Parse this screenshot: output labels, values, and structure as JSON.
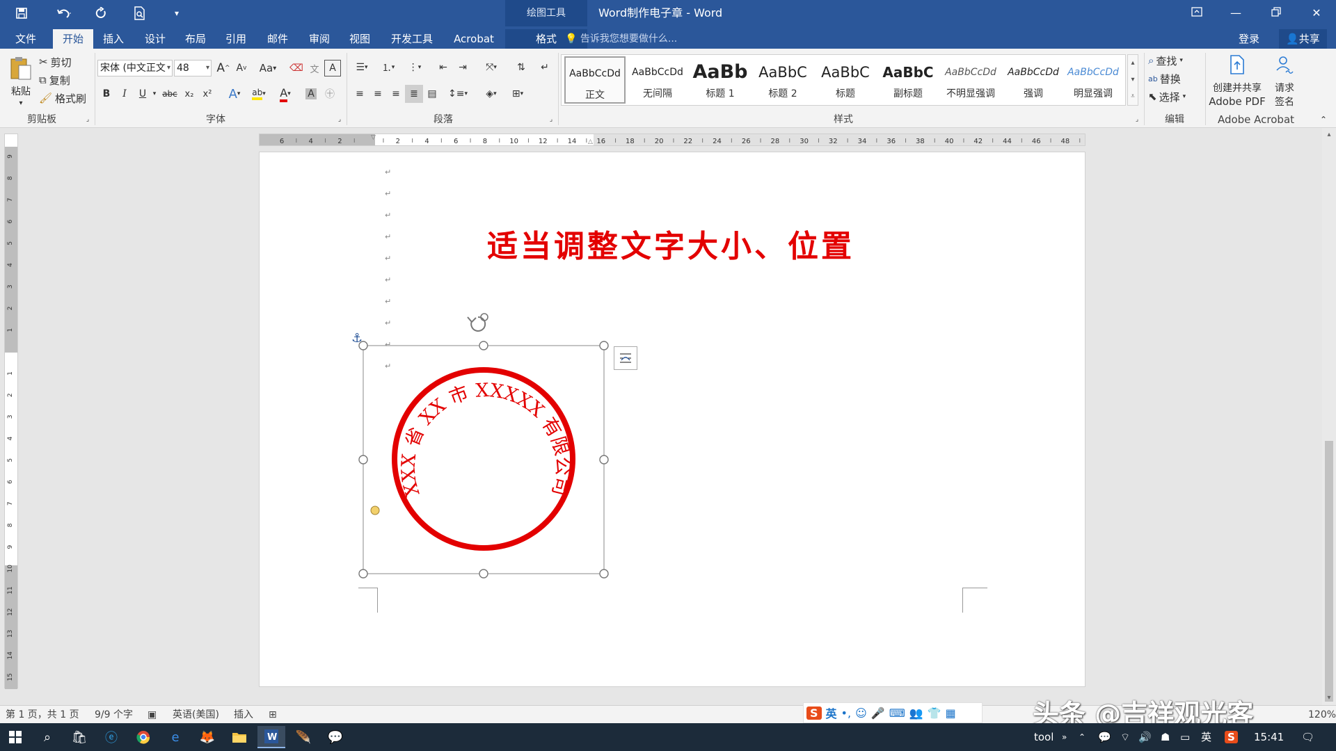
{
  "window": {
    "title": "Word制作电子章 - Word",
    "tools_label": "绘图工具",
    "quick_access": [
      "save-icon",
      "undo-icon",
      "redo-icon",
      "print-preview-icon",
      "customize-icon"
    ],
    "controls": [
      "ribbon-display-icon",
      "minimize-icon",
      "restore-icon",
      "close-icon"
    ]
  },
  "tabs": {
    "file": "文件",
    "home": "开始",
    "insert": "插入",
    "design": "设计",
    "layout": "布局",
    "references": "引用",
    "mailings": "邮件",
    "review": "审阅",
    "view": "视图",
    "developer": "开发工具",
    "acrobat": "Acrobat",
    "format": "格式",
    "tell_me": "告诉我您想要做什么...",
    "login": "登录",
    "share": "共享"
  },
  "ribbon": {
    "clipboard": {
      "label": "剪贴板",
      "paste": "粘贴",
      "cut": "剪切",
      "copy": "复制",
      "format_painter": "格式刷"
    },
    "font": {
      "label": "字体",
      "family": "宋体 (中文正文",
      "size": "48",
      "grow": "A",
      "shrink": "A",
      "case": "Aa",
      "bold": "B",
      "italic": "I",
      "underline": "U",
      "strike": "abc",
      "subscript": "x₂",
      "superscript": "x²",
      "font_color": "A",
      "shading": "A"
    },
    "paragraph": {
      "label": "段落"
    },
    "styles": {
      "label": "样式",
      "items": [
        {
          "sample": "AaBbCcDd",
          "name": "正文"
        },
        {
          "sample": "AaBbCcDd",
          "name": "无间隔"
        },
        {
          "sample": "AaBb",
          "name": "标题 1"
        },
        {
          "sample": "AaBbC",
          "name": "标题 2"
        },
        {
          "sample": "AaBbC",
          "name": "标题"
        },
        {
          "sample": "AaBbC",
          "name": "副标题"
        },
        {
          "sample": "AaBbCcDd",
          "name": "不明显强调"
        },
        {
          "sample": "AaBbCcDd",
          "name": "强调"
        },
        {
          "sample": "AaBbCcDd",
          "name": "明显强调"
        }
      ]
    },
    "editing": {
      "label": "编辑",
      "find": "查找",
      "replace": "替换",
      "select": "选择"
    },
    "acrobat": {
      "label": "Adobe Acrobat",
      "create_line1": "创建并共享",
      "create_line2": "Adobe PDF",
      "sign_line1": "请求",
      "sign_line2": "签名"
    }
  },
  "ruler": {
    "h_labels": [
      "6",
      "4",
      "2",
      "",
      "2",
      "4",
      "6",
      "8",
      "10",
      "12",
      "14",
      "16",
      "18",
      "20",
      "22",
      "24",
      "26",
      "28",
      "30",
      "32",
      "34",
      "36",
      "38",
      "40",
      "42",
      "44",
      "46",
      "48"
    ],
    "v_labels": [
      "9",
      "8",
      "7",
      "6",
      "5",
      "4",
      "3",
      "2",
      "1",
      "",
      "1",
      "2",
      "3",
      "4",
      "5",
      "6",
      "7",
      "8",
      "9",
      "10",
      "11",
      "12",
      "13",
      "14",
      "15"
    ],
    "corner": "L"
  },
  "document": {
    "heading": "适当调整文字大小、位置",
    "paragraph_mark": "↵",
    "stamp": {
      "arc_text": "XXX 省 XX 市 XXXXX 有限公司",
      "color": "#e30000"
    }
  },
  "status": {
    "page": "第 1 页，共 1 页",
    "words": "9/9 个字",
    "language": "英语(美国)",
    "mode": "插入",
    "zoom": "120%"
  },
  "ime": {
    "lang": "英",
    "punct": "•,"
  },
  "watermark": "头条 @吉祥观光客",
  "taskbar": {
    "tool": "tool",
    "lang": "英",
    "time": "15:41"
  }
}
